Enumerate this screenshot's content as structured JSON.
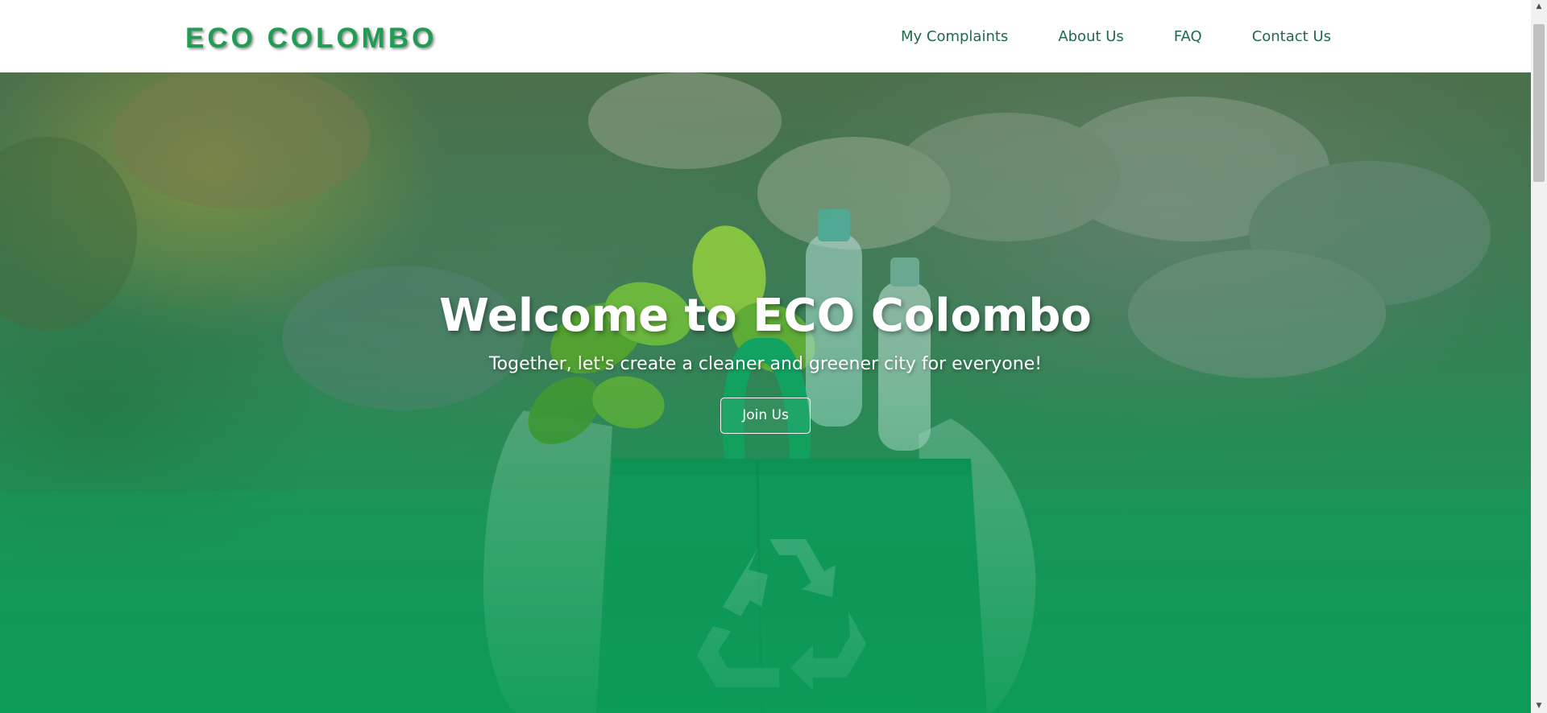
{
  "header": {
    "brand": "ECO COLOMBO",
    "nav": [
      {
        "label": "My Complaints"
      },
      {
        "label": "About Us"
      },
      {
        "label": "FAQ"
      },
      {
        "label": "Contact Us"
      }
    ]
  },
  "hero": {
    "title": "Welcome to ECO Colombo",
    "subtitle": "Together, let's create a cleaner and greener city for everyone!",
    "button_label": "Join Us",
    "background_image": "eco-bag-with-plants-and-bottles",
    "icon": "recycle-icon"
  },
  "colors": {
    "brand_green": "#1f9d55",
    "nav_text": "#1e6a4a",
    "hero_bottom": "#10995a"
  },
  "scrollbar": {
    "up_icon": "chevron-up-icon",
    "down_icon": "chevron-down-icon"
  }
}
